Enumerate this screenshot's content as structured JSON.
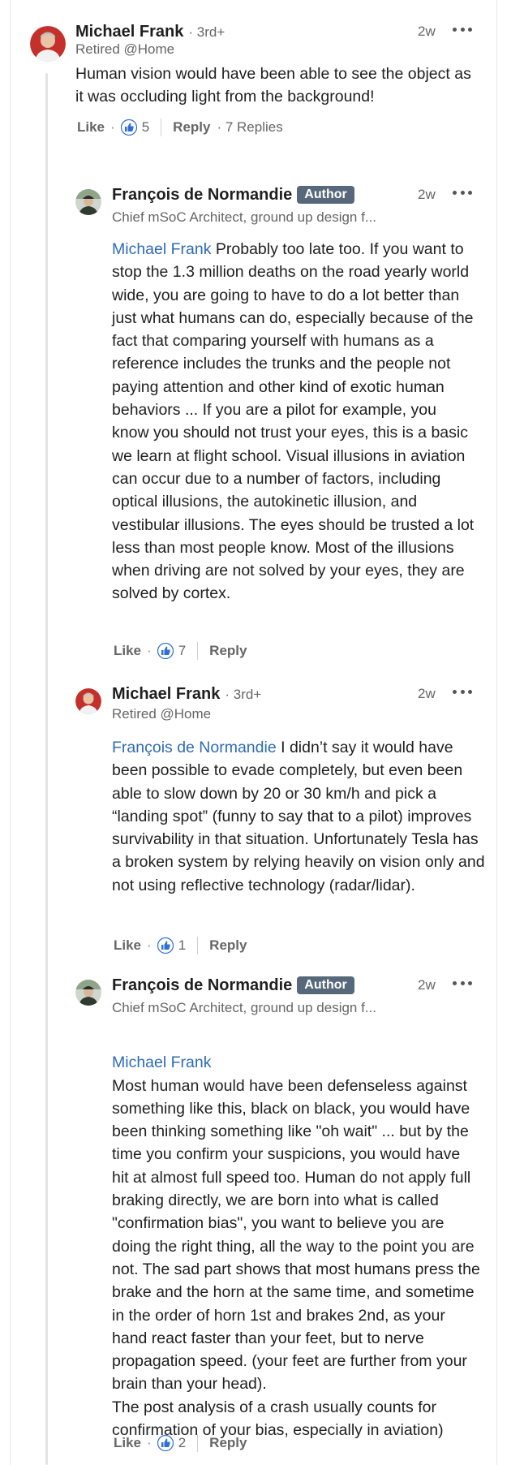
{
  "colors": {
    "mention": "#2e6bb5",
    "badge": "#56687a",
    "like": "#2f6fd1"
  },
  "comments": [
    {
      "author": "Michael Frank",
      "degree": "· 3rd+",
      "badge": "",
      "headline": "Retired @Home",
      "time": "2w",
      "mention": "",
      "text": "Human vision would have been able to see the object as it was occluding light from the background!",
      "like_label": "Like",
      "like_count": "5",
      "reply_label": "Reply",
      "replies_text": "· 7 Replies",
      "avatar": "man-red-background-avatar"
    },
    {
      "author": "François de Normandie",
      "degree": "",
      "badge": "Author",
      "headline": "Chief mSoC Architect, ground up design f...",
      "time": "2w",
      "mention": "Michael Frank",
      "text": "Probably too late too. If you want to stop the 1.3 million deaths on the road yearly world wide, you are going to have to do a lot better than just what humans can do, especially because of the fact that comparing yourself with humans as a reference includes the trunks and the people not paying attention and other kind of exotic human behaviors ... If you are a pilot for example, you know you should not trust your eyes, this is a basic we learn at flight school. Visual illusions in aviation can occur due to a number of factors, including optical illusions, the autokinetic illusion, and vestibular illusions. The eyes should be trusted a lot less than most people know. Most of the illusions when driving are not solved by your eyes, they are solved by cortex.",
      "like_label": "Like",
      "like_count": "7",
      "reply_label": "Reply",
      "avatar": "man-cap-avatar"
    },
    {
      "author": "Michael Frank",
      "degree": "· 3rd+",
      "badge": "",
      "headline": "Retired @Home",
      "time": "2w",
      "mention": "François de Normandie",
      "text": "I didn’t say it would have been possible to evade completely, but even been able to slow down by 20 or 30 km/h and pick a “landing spot” (funny to say that to a pilot) improves survivability in that situation. Unfortunately Tesla has a broken system by relying heavily on vision only and not using reflective technology (radar/lidar).",
      "like_label": "Like",
      "like_count": "1",
      "reply_label": "Reply",
      "avatar": "man-red-background-avatar"
    },
    {
      "author": "François de Normandie",
      "degree": "",
      "badge": "Author",
      "headline": "Chief mSoC Architect, ground up design f...",
      "time": "2w",
      "mention": "Michael Frank",
      "text": "Most human would have been defenseless against something like this, black on black, you would have been thinking something like \"oh wait\" ... but by the time you confirm your suspicions, you would have hit at almost full speed too. Human do not apply full braking directly, we are born into what is called \"confirmation bias\", you want to believe you are doing the right thing, all the way to the point you are not. The sad part shows that most humans press the brake and the horn at the same time, and sometime in the order of horn 1st and brakes 2nd, as your hand react faster than your feet, but to nerve propagation speed. (your feet are further from your brain than your head).\nThe post analysis of a crash usually counts for confirmation of your bias, especially in aviation)",
      "like_label": "Like",
      "like_count": "2",
      "reply_label": "Reply",
      "avatar": "man-cap-avatar"
    }
  ]
}
